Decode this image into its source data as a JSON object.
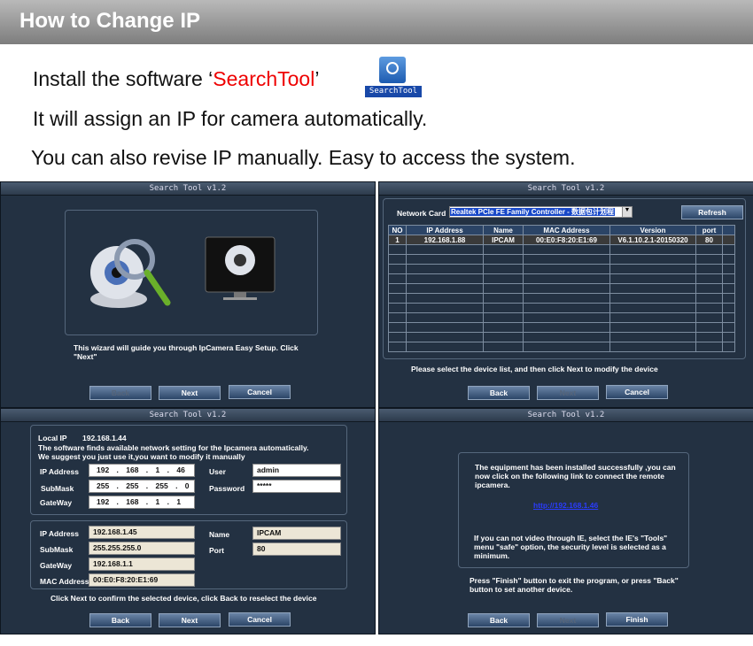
{
  "header": {
    "title": "How to Change IP"
  },
  "intro": {
    "line1_prefix": "Install the software ‘",
    "line1_highlight": "SearchTool",
    "line1_suffix": "’",
    "icon_label": "SearchTool",
    "line2": "It will assign an IP for camera automatically.",
    "line3": "You can also revise IP manually. Easy to access the system."
  },
  "window_title": "Search Tool v1.2",
  "buttons": {
    "back": "Back",
    "next": "Next",
    "cancel": "Cancel",
    "finish": "Finish",
    "refresh": "Refresh"
  },
  "panel1": {
    "text": "This wizard will guide you through IpCamera Easy Setup. Click \"Next\""
  },
  "panel2": {
    "network_card_label": "Network Card",
    "network_card_value": "Realtek PCIe FE Family Controller - 数据包计划程",
    "columns": [
      "NO",
      "IP Address",
      "Name",
      "MAC Address",
      "Version",
      "port"
    ],
    "rows": [
      [
        "1",
        "192.168.1.88",
        "IPCAM",
        "00:E0:F8:20:E1:69",
        "V6.1.10.2.1-20150320",
        "80"
      ]
    ],
    "hint": "Please select the device list, and then click Next to modify the device"
  },
  "panel3": {
    "local_ip_label": "Local IP",
    "local_ip": "192.168.1.44",
    "info1": "The software finds available network setting for the Ipcamera automatically.",
    "info2": "We suggest you just use it,you want to modify it manually",
    "ip_label": "IP Address",
    "ip": "192 . 168 . 1 . 46",
    "mask_label": "SubMask",
    "mask": "255 . 255 . 255 . 0",
    "gw_label": "GateWay",
    "gw": "192 . 168 . 1 . 1",
    "user_label": "User",
    "user": "admin",
    "pass_label": "Password",
    "pass": "*****",
    "dev_ip": "192.168.1.45",
    "dev_mask": "255.255.255.0",
    "dev_gw": "192.168.1.1",
    "mac_label": "MAC Address",
    "dev_mac": "00:E0:F8:20:E1:69",
    "name_label": "Name",
    "dev_name": "IPCAM",
    "port_label": "Port",
    "dev_port": "80",
    "hint": "Click Next to confirm the selected device, click Back to reselect the device"
  },
  "panel4": {
    "msg": "The equipment has been installed successfully ,you can now click on the following link to connect the remote ipcamera.",
    "link": "http://192.168.1.46",
    "ie_note": "If you can not video through IE, select the IE's \"Tools\" menu  \"safe\" option, the security level is selected as a minimum.",
    "hint": "Press \"Finish\" button to exit the program, or press \"Back\" button to set another device."
  }
}
